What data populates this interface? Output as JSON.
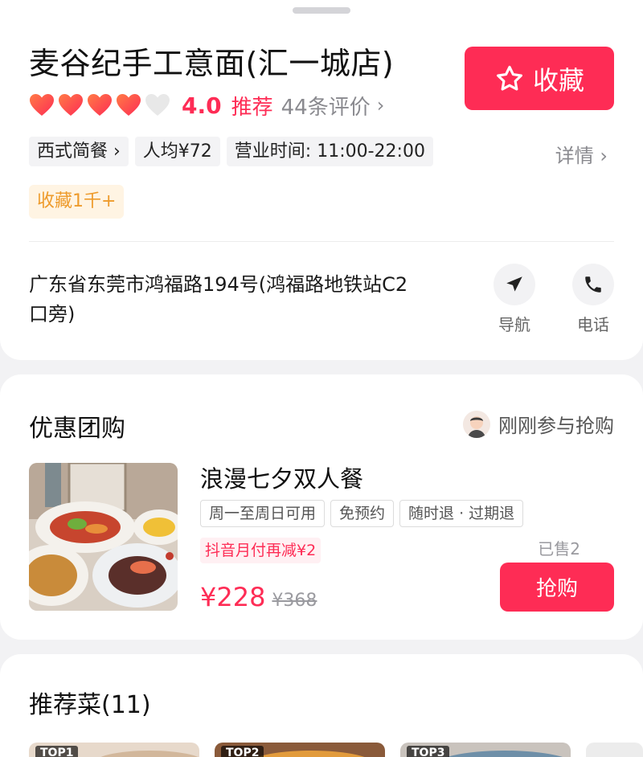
{
  "shop": {
    "title": "麦谷纪手工意面(汇一城店)",
    "favorite_label": "收藏",
    "rating": {
      "hearts_filled": 4,
      "hearts_total": 5,
      "score": "4.0",
      "tag": "推荐",
      "reviews": "44条评价",
      "chevron": "›"
    },
    "tags": [
      "西式简餐 ›",
      "人均¥72",
      "营业时间: 11:00-22:00"
    ],
    "details_label": "详情 ›",
    "collect_badge": "收藏1千+",
    "address": "广东省东莞市鸿福路194号(鸿福路地铁站C2口旁)",
    "actions": {
      "navigate": "导航",
      "phone": "电话"
    }
  },
  "deal_section": {
    "title": "优惠团购",
    "recent_buyers": "刚刚参与抢购",
    "deal": {
      "name": "浪漫七夕双人餐",
      "tags": [
        "周一至周日可用",
        "免预约",
        "随时退 · 过期退"
      ],
      "promo": "抖音月付再减¥2",
      "sold": "已售2",
      "price": "¥228",
      "original_price": "¥368",
      "buy_label": "抢购"
    }
  },
  "dishes_section": {
    "title": "推荐菜(11)",
    "items": [
      {
        "badge": "TOP1"
      },
      {
        "badge": "TOP2"
      },
      {
        "badge": "TOP3"
      }
    ]
  },
  "colors": {
    "accent": "#fe2c55",
    "badge_bg": "#fff4e3",
    "badge_text": "#ee9b2c",
    "heart_empty": "#e8e8e8"
  },
  "icons": {
    "favorite": "star-outline-icon",
    "navigate": "navigation-arrow-icon",
    "phone": "phone-icon",
    "heart": "heart-icon"
  }
}
